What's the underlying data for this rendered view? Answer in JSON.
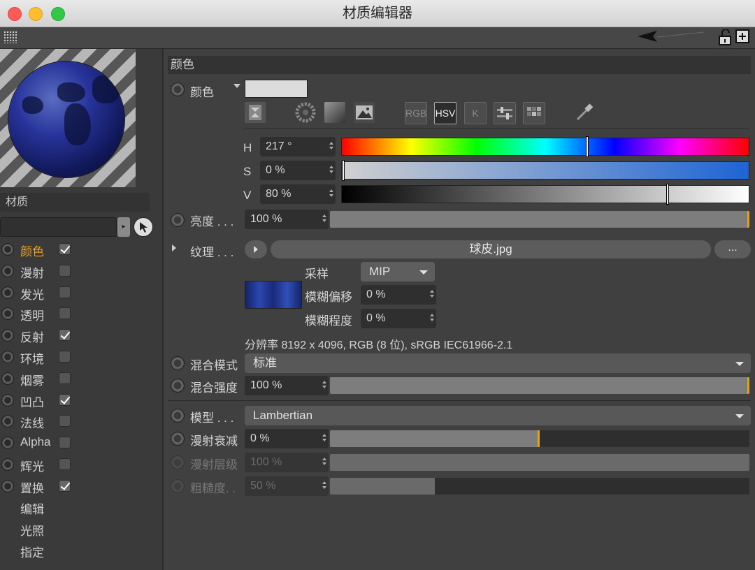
{
  "window": {
    "title": "材质编辑器"
  },
  "sidebar": {
    "panel_label": "材质",
    "channels": [
      {
        "label": "颜色",
        "checked": true,
        "active": true
      },
      {
        "label": "漫射",
        "checked": false
      },
      {
        "label": "发光",
        "checked": false
      },
      {
        "label": "透明",
        "checked": false
      },
      {
        "label": "反射",
        "checked": true
      },
      {
        "label": "环境",
        "checked": false
      },
      {
        "label": "烟雾",
        "checked": false
      },
      {
        "label": "凹凸",
        "checked": true
      },
      {
        "label": "法线",
        "checked": false
      },
      {
        "label": "Alpha",
        "checked": false
      },
      {
        "label": "辉光",
        "checked": false
      },
      {
        "label": "置换",
        "checked": true
      }
    ],
    "extras": [
      "编辑",
      "光照",
      "指定"
    ]
  },
  "main": {
    "section_title": "颜色",
    "color_label": "颜色",
    "color_swatch": "#dcdcdc",
    "mode_buttons": [
      "RGB",
      "HSV",
      "K"
    ],
    "hsv": {
      "h_label": "H",
      "h_value": "217 °",
      "s_label": "S",
      "s_value": "0 %",
      "v_label": "V",
      "v_value": "80 %",
      "h_fraction": 0.603,
      "s_fraction": 0.0,
      "v_fraction": 0.8
    },
    "brightness": {
      "label": "亮度 . . .",
      "value": "100 %",
      "fraction": 1.0
    },
    "texture": {
      "label": "纹理 . . .",
      "file": "球皮.jpg",
      "more": "...",
      "sampling_label": "采样",
      "sampling_value": "MIP",
      "blur_offset_label": "模糊偏移",
      "blur_offset_value": "0 %",
      "blur_scale_label": "模糊程度",
      "blur_scale_value": "0 %",
      "resolution": "分辨率 8192 x 4096, RGB (8 位), sRGB IEC61966-2.1"
    },
    "mix_mode": {
      "label": "混合模式",
      "value": "标准"
    },
    "mix_strength": {
      "label": "混合强度",
      "value": "100 %",
      "fraction": 1.0
    },
    "model": {
      "label": "模型 . . .",
      "value": "Lambertian"
    },
    "diffuse_falloff": {
      "label": "漫射衰减",
      "value": "0 %",
      "fraction": 0.5
    },
    "diffuse_level": {
      "label": "漫射层级",
      "value": "100 %",
      "fraction": 1.0
    },
    "roughness": {
      "label": "粗糙度. .",
      "value": "50 %",
      "fraction": 0.25
    }
  },
  "colors": {
    "accent": "#f0a020",
    "active_label": "#f0a020"
  }
}
